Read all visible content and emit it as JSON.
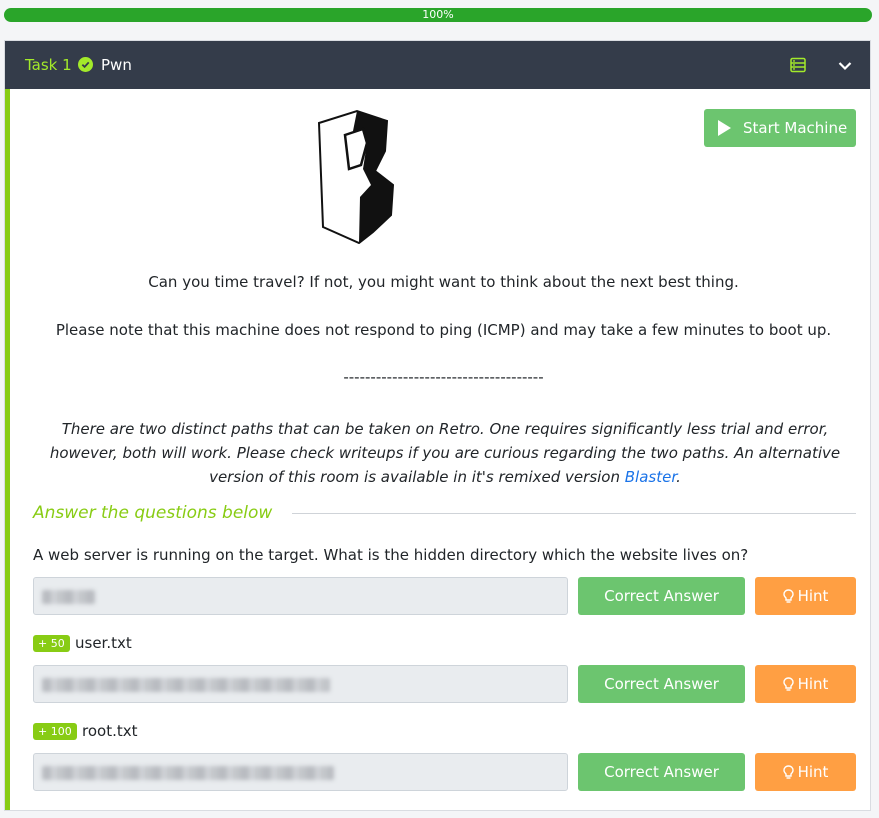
{
  "progress": {
    "label": "100%",
    "value": 1.0
  },
  "task": {
    "number_label": "Task 1",
    "title": "Pwn",
    "start_button_label": "Start Machine",
    "description": {
      "line1": "Can you time travel? If not, you might want to think about the next best thing.",
      "line2": "Please note that this machine does not respond to ping (ICMP) and may take a few minutes to boot up.",
      "separator": "-------------------------------------",
      "italic_text": "There are two distinct paths that can be taken on Retro. One requires significantly less trial and error, however, both will work. Please check writeups if you are curious regarding the two paths. An alternative version of this room is available in it's remixed version ",
      "link_text": "Blaster",
      "italic_end": "."
    },
    "answer_heading": "Answer the questions below",
    "questions": [
      {
        "text": "A web server is running on the target. What is the hidden directory which the website lives on?",
        "badge": "",
        "correct_label": "Correct Answer",
        "hint_label": "Hint"
      },
      {
        "text": "user.txt",
        "badge": "+ 50",
        "correct_label": "Correct Answer",
        "hint_label": "Hint"
      },
      {
        "text": "root.txt",
        "badge": "+ 100",
        "correct_label": "Correct Answer",
        "hint_label": "Hint"
      }
    ]
  },
  "colors": {
    "accent": "#88cc14",
    "header_bg": "#343c4a",
    "success": "#6cc56f",
    "hint": "#ff9f43",
    "link": "#1a73e8"
  },
  "icons": [
    "check-circle-icon",
    "server-icon",
    "chevron-down-icon",
    "play-icon",
    "arcade-cabinet-icon",
    "lightbulb-icon"
  ]
}
